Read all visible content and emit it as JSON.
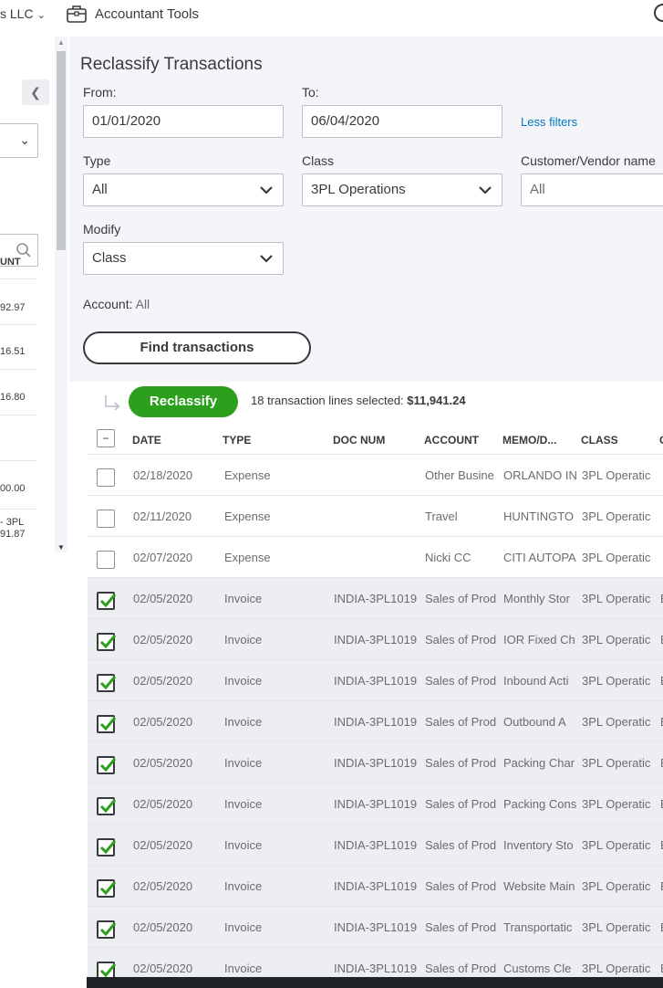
{
  "topbar": {
    "company_fragment": "s LLC",
    "accountant_tools": "Accountant Tools"
  },
  "left_panel": {
    "column_header": "UNT",
    "values": [
      "92.97",
      "16.51",
      "16.80",
      "00.00"
    ],
    "last_row_line1": "- 3PL",
    "last_row_line2": "91.87"
  },
  "reclassify": {
    "title": "Reclassify Transactions",
    "from_label": "From:",
    "from_value": "01/01/2020",
    "to_label": "To:",
    "to_value": "06/04/2020",
    "less_filters": "Less filters",
    "type_label": "Type",
    "type_value": "All",
    "class_label": "Class",
    "class_value": "3PL Operations",
    "customer_label": "Customer/Vendor name",
    "customer_value": "All",
    "modify_label": "Modify",
    "modify_value": "Class",
    "account_label": "Account:",
    "account_value": "All",
    "find_button": "Find transactions",
    "reclassify_button": "Reclassify",
    "selected_text": "18 transaction lines selected:",
    "selected_amount": "$11,941.24"
  },
  "table": {
    "columns": [
      "DATE",
      "TYPE",
      "DOC NUM",
      "ACCOUNT",
      "MEMO/D...",
      "CLASS",
      "C"
    ],
    "rows": [
      {
        "checked": false,
        "date": "02/18/2020",
        "type": "Expense",
        "doc": "",
        "account": "Other Busine",
        "memo": "ORLANDO IN",
        "class": "3PL Operatic",
        "extra": ""
      },
      {
        "checked": false,
        "date": "02/11/2020",
        "type": "Expense",
        "doc": "",
        "account": "Travel",
        "memo": "HUNTINGTO",
        "class": "3PL Operatic",
        "extra": ""
      },
      {
        "checked": false,
        "date": "02/07/2020",
        "type": "Expense",
        "doc": "",
        "account": "Nicki CC",
        "memo": "CITI AUTOPA",
        "class": "3PL Operatic",
        "extra": ""
      },
      {
        "checked": true,
        "date": "02/05/2020",
        "type": "Invoice",
        "doc": "INDIA-3PL1019",
        "account": "Sales of Prod",
        "memo": "Monthly Stor",
        "class": "3PL Operatic",
        "extra": "E"
      },
      {
        "checked": true,
        "date": "02/05/2020",
        "type": "Invoice",
        "doc": "INDIA-3PL1019",
        "account": "Sales of Prod",
        "memo": "IOR Fixed Ch",
        "class": "3PL Operatic",
        "extra": "E"
      },
      {
        "checked": true,
        "date": "02/05/2020",
        "type": "Invoice",
        "doc": "INDIA-3PL1019",
        "account": "Sales of Prod",
        "memo": "Inbound Acti",
        "class": "3PL Operatic",
        "extra": "E"
      },
      {
        "checked": true,
        "date": "02/05/2020",
        "type": "Invoice",
        "doc": "INDIA-3PL1019",
        "account": "Sales of Prod",
        "memo": "Outbound A",
        "class": "3PL Operatic",
        "extra": "E"
      },
      {
        "checked": true,
        "date": "02/05/2020",
        "type": "Invoice",
        "doc": "INDIA-3PL1019",
        "account": "Sales of Prod",
        "memo": "Packing Char",
        "class": "3PL Operatic",
        "extra": "E"
      },
      {
        "checked": true,
        "date": "02/05/2020",
        "type": "Invoice",
        "doc": "INDIA-3PL1019",
        "account": "Sales of Prod",
        "memo": "Packing Cons",
        "class": "3PL Operatic",
        "extra": "E"
      },
      {
        "checked": true,
        "date": "02/05/2020",
        "type": "Invoice",
        "doc": "INDIA-3PL1019",
        "account": "Sales of Prod",
        "memo": "Inventory Sto",
        "class": "3PL Operatic",
        "extra": "E"
      },
      {
        "checked": true,
        "date": "02/05/2020",
        "type": "Invoice",
        "doc": "INDIA-3PL1019",
        "account": "Sales of Prod",
        "memo": "Website Main",
        "class": "3PL Operatic",
        "extra": "E"
      },
      {
        "checked": true,
        "date": "02/05/2020",
        "type": "Invoice",
        "doc": "INDIA-3PL1019",
        "account": "Sales of Prod",
        "memo": "Transportatic",
        "class": "3PL Operatic",
        "extra": "E"
      },
      {
        "checked": true,
        "date": "02/05/2020",
        "type": "Invoice",
        "doc": "INDIA-3PL1019",
        "account": "Sales of Prod",
        "memo": "Customs Cle",
        "class": "3PL Operatic",
        "extra": "E"
      }
    ]
  },
  "colors": {
    "accent_green": "#2ca01c",
    "link_blue": "#0077c5",
    "panel_bg": "#f4f5f8",
    "checked_row_bg": "#eceef1"
  }
}
